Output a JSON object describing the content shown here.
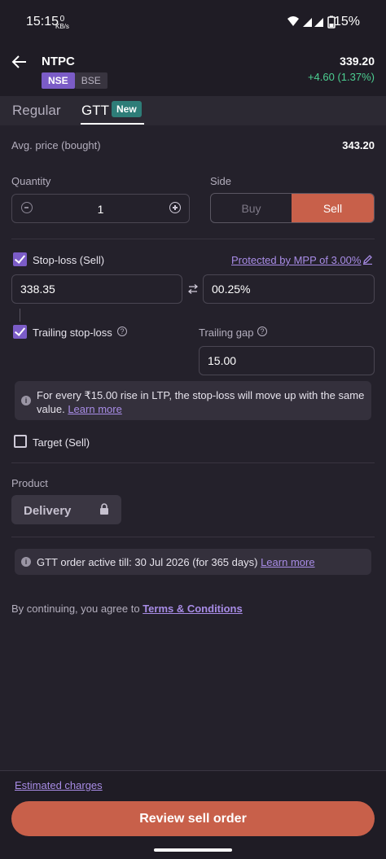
{
  "status_bar": {
    "time": "15:15",
    "net_speed_value": "0",
    "net_speed_unit": "KB/s",
    "battery": "15%"
  },
  "header": {
    "symbol": "NTPC",
    "exchange_active": "NSE",
    "exchange_inactive": "BSE",
    "ltp": "339.20",
    "change": "+4.60 (1.37%)",
    "change_color": "#4ccf91"
  },
  "tabs": {
    "regular": "Regular",
    "gtt": "GTT",
    "gtt_badge": "New"
  },
  "avg_price": {
    "label": "Avg. price (bought)",
    "value": "343.20"
  },
  "quantity": {
    "label": "Quantity",
    "value": "1"
  },
  "side": {
    "label": "Side",
    "buy": "Buy",
    "sell": "Sell",
    "selected": "Sell"
  },
  "stoploss": {
    "label": "Stop-loss (Sell)",
    "checked": true,
    "mpp_link": "Protected by MPP of 3.00%",
    "price": "338.35",
    "percent": "00.25%"
  },
  "trailing": {
    "label": "Trailing stop-loss",
    "checked": true,
    "gap_label": "Trailing gap",
    "gap_value": "15.00",
    "info_text": "For every ₹15.00 rise in LTP, the stop-loss will move up with the same value.",
    "info_link": "Learn more"
  },
  "target": {
    "label": "Target (Sell)",
    "checked": false
  },
  "product": {
    "label": "Product",
    "value": "Delivery"
  },
  "gtt_info": {
    "text": "GTT order active till: 30 Jul 2026 (for 365 days)",
    "link": "Learn more"
  },
  "terms": {
    "prefix": "By continuing, you agree to",
    "link": "Terms & Conditions"
  },
  "footer": {
    "estimated_charges": "Estimated charges",
    "review_button": "Review sell order"
  },
  "colors": {
    "accent_purple": "#7b5cc7",
    "sell_red": "#c8604a",
    "background": "#24212b"
  }
}
